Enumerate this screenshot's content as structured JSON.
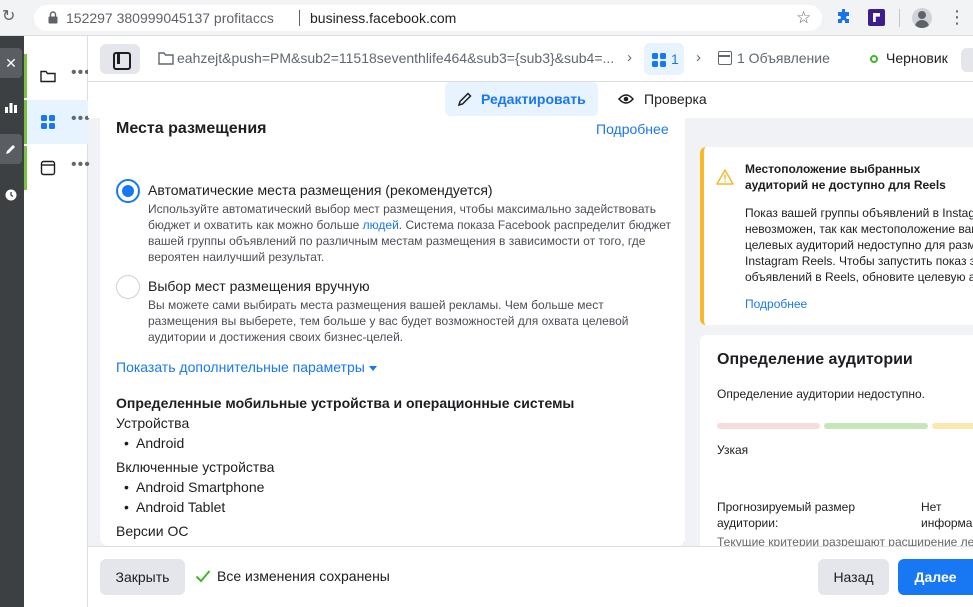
{
  "browser": {
    "profile": "152297 380999045137 profitaccs",
    "url": "business.facebook.com"
  },
  "toolbar": {
    "campaign_name": "eahzejt&push=PM&sub2=11518seventhlife464&sub3={sub3}&sub4=...",
    "adset_count": "1",
    "ad_label": "1 Объявление",
    "status": "Черновик"
  },
  "tabs": {
    "edit": "Редактировать",
    "review": "Проверка"
  },
  "placements": {
    "title": "Места размещения",
    "more_link": "Подробнее",
    "auto": {
      "title": "Автоматические места размещения (рекомендуется)",
      "desc_pre": "Используйте автоматический выбор мест размещения, чтобы максимально задействовать бюджет и охватить как можно больше ",
      "desc_link": "людей",
      "desc_post": ". Система показа Facebook распределит бюджет вашей группы объявлений по различным местам размещения в зависимости от того, где вероятен наилучший результат."
    },
    "manual": {
      "title": "Выбор мест размещения вручную",
      "desc": "Вы можете сами выбирать места размещения вашей рекламы. Чем больше мест размещения вы выберете, тем больше у вас будет возможностей для охвата целевой аудитории и достижения своих бизнес-целей."
    },
    "advanced_link": "Показать дополнительные параметры",
    "devices_title": "Определенные мобильные устройства и операционные системы",
    "devices_label": "Устройства",
    "devices": [
      "Android"
    ],
    "included_label": "Включенные устройства",
    "included": [
      "Android Smartphone",
      "Android Tablet"
    ],
    "os_label": "Версии ОС"
  },
  "warning": {
    "title": "Местоположение выбранных аудиторий не доступно для Reels",
    "body": "Показ вашей группы объявлений в Instag\nневозможен, так как местоположение ваш\nцелевых аудиторий недоступно для разм\nInstagram Reels. Чтобы запустить показ э\nобъявлений в Reels, обновите целевую ау",
    "link": "Подробнее"
  },
  "audience": {
    "title": "Определение аудитории",
    "subtitle": "Определение аудитории недоступно.",
    "scale_label": "Узкая",
    "estimate_label": "Прогнозируемый размер аудитории:",
    "estimate_value": "Нет\nинформа",
    "bottom_text": "Текущие критерии разрешают расширение ле"
  },
  "footer": {
    "close": "Закрыть",
    "saved": "Все изменения сохранены",
    "back": "Назад",
    "next": "Далее"
  },
  "colors": {
    "accent": "#1877f2",
    "status_green": "#42b72a",
    "warning_yellow": "#f7b928"
  }
}
